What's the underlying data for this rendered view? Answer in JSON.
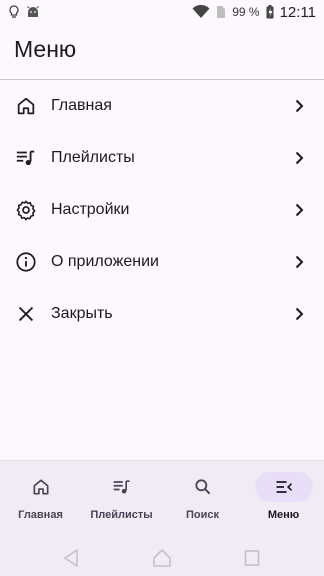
{
  "status": {
    "battery": "99 %",
    "time": "12:11"
  },
  "title": "Меню",
  "menu": [
    {
      "label": "Главная",
      "icon": "home-icon"
    },
    {
      "label": "Плейлисты",
      "icon": "playlist-icon"
    },
    {
      "label": "Настройки",
      "icon": "gear-icon"
    },
    {
      "label": "О приложении",
      "icon": "info-icon"
    },
    {
      "label": "Закрыть",
      "icon": "close-icon"
    }
  ],
  "nav": [
    {
      "label": "Главная",
      "icon": "home-icon",
      "active": false
    },
    {
      "label": "Плейлисты",
      "icon": "playlist-icon",
      "active": false
    },
    {
      "label": "Поиск",
      "icon": "search-icon",
      "active": false
    },
    {
      "label": "Меню",
      "icon": "menu-icon",
      "active": true
    }
  ],
  "colors": {
    "background": "#fdf8fd",
    "active_indicator": "#e8def8",
    "nav_background": "#f1ecf3"
  }
}
